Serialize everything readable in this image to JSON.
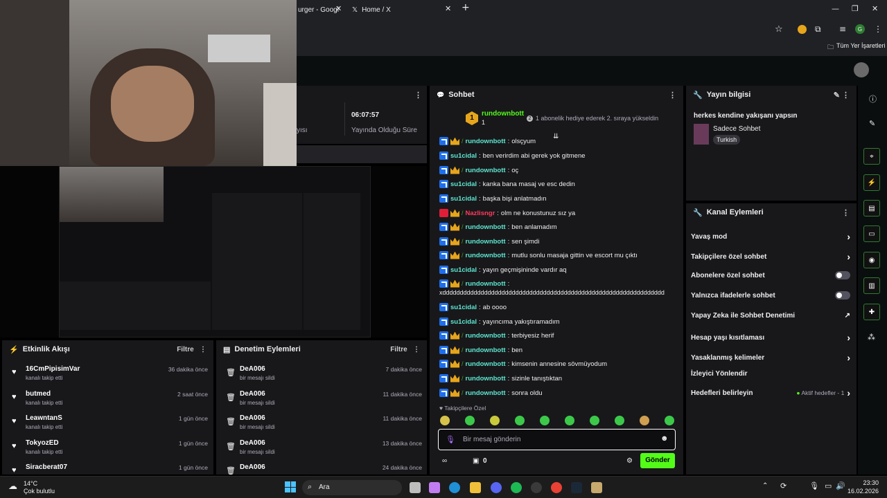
{
  "browser": {
    "tab1_label": "urger - Googl",
    "tab2_label": "Home / X",
    "new_tab": "+",
    "bookmarks_label": "Tüm Yer İşaretleri",
    "profile_initial": "G"
  },
  "stats": {
    "time_value": "06:07:57",
    "time_label": "Yayında Olduğu Süre",
    "partial_label": "yısı"
  },
  "chat": {
    "title": "Sohbet",
    "pinned_user": "rundownbott",
    "pinned_count": "1",
    "pinned_rank": "1",
    "gift_badge": "2",
    "gift_text": "1 abonelik hediye ederek 2. sıraya yükseldin",
    "messages": [
      {
        "badge": "mod",
        "crown": true,
        "user": "rundownbott",
        "color": "teal",
        "text": " olsçyum"
      },
      {
        "badge": "mod",
        "crown": false,
        "user": "su1cidal",
        "color": "teal",
        "text": "ben verirdim abi gerek yok gitmene"
      },
      {
        "badge": "mod",
        "crown": true,
        "user": "rundownbott",
        "color": "teal",
        "text": "oç"
      },
      {
        "badge": "mod",
        "crown": false,
        "user": "su1cidal",
        "color": "teal",
        "text": "kanka bana masaj ve esc dedin"
      },
      {
        "badge": "mod",
        "crown": false,
        "user": "su1cidal",
        "color": "teal",
        "text": "başka bişi anlatmadın"
      },
      {
        "badge": "red",
        "crown": true,
        "user": "Nazlisngr",
        "color": "red",
        "text": "olm ne konustunuz sız ya"
      },
      {
        "badge": "mod",
        "crown": true,
        "user": "rundownbott",
        "color": "teal",
        "text": "ben anlamadım"
      },
      {
        "badge": "mod",
        "crown": true,
        "user": "rundownbott",
        "color": "teal",
        "text": "sen şimdi"
      },
      {
        "badge": "mod",
        "crown": true,
        "user": "rundownbott",
        "color": "teal",
        "text": "mutlu sonlu masaja gittin ve escort mu çıktı"
      },
      {
        "badge": "mod",
        "crown": false,
        "user": "su1cidal",
        "color": "teal",
        "text": "yayın geçmişininde vardır aq"
      },
      {
        "badge": "mod",
        "crown": true,
        "user": "rundownbott",
        "color": "teal",
        "text": ""
      },
      {
        "badge": "none",
        "crown": false,
        "user": "",
        "color": "teal",
        "text": "xdddddddddddddddddddddddddddddddddddddddddddddddddddddddddddddddd"
      },
      {
        "badge": "mod",
        "crown": false,
        "user": "su1cidal",
        "color": "teal",
        "text": "ab oooo"
      },
      {
        "badge": "mod",
        "crown": false,
        "user": "su1cidal",
        "color": "teal",
        "text": "yayıncıma yakıştıramadım"
      },
      {
        "badge": "mod",
        "crown": true,
        "user": "rundownbott",
        "color": "teal",
        "text": "terbiyesiz herif"
      },
      {
        "badge": "mod",
        "crown": true,
        "user": "rundownbott",
        "color": "teal",
        "text": "ben"
      },
      {
        "badge": "mod",
        "crown": true,
        "user": "rundownbott",
        "color": "teal",
        "text": "kimsenin annesine sövmüyodum"
      },
      {
        "badge": "mod",
        "crown": true,
        "user": "rundownbott",
        "color": "teal",
        "text": "sizinle tanıştıktan"
      },
      {
        "badge": "mod",
        "crown": true,
        "user": "rundownbott",
        "color": "teal",
        "text": "sonra oldu"
      }
    ],
    "followers_only": "Takipçilere Özel",
    "input_placeholder": "Bir mesaj gönderin",
    "points": "0",
    "send_label": "Gönder"
  },
  "stream_info": {
    "title": "Yayın bilgisi",
    "stream_title": "herkes kendine yakışanı yapsın",
    "category": "Sadece Sohbet",
    "tag": "Turkish"
  },
  "channel_actions": {
    "title": "Kanal Eylemleri",
    "items": [
      {
        "label": "Yavaş mod",
        "type": "chevron"
      },
      {
        "label": "Takipçilere özel sohbet",
        "type": "chevron"
      },
      {
        "label": "Abonelere özel sohbet",
        "type": "toggle"
      },
      {
        "label": "Yalnızca ifadelerle sohbet",
        "type": "toggle"
      },
      {
        "label": "Yapay Zeka ile Sohbet Denetimi",
        "type": "external"
      },
      {
        "label": "Hesap yaşı kısıtlaması",
        "type": "chevron"
      },
      {
        "label": "Yasaklanmış kelimeler",
        "type": "chevron"
      },
      {
        "label": "İzleyici Yönlendir",
        "type": "none"
      },
      {
        "label": "Hedefleri belirleyin",
        "type": "goal"
      }
    ],
    "goal_status": "Aktif hedefler - 1"
  },
  "activity": {
    "title": "Etkinlik Akışı",
    "filter": "Filtre",
    "rows": [
      {
        "name": "16CmPipisimVar",
        "sub": "kanalı takip etti",
        "time": "36 dakika önce"
      },
      {
        "name": "butmed",
        "sub": "kanalı takip etti",
        "time": "2 saat önce"
      },
      {
        "name": "LeawntanS",
        "sub": "kanalı takip etti",
        "time": "1 gün önce"
      },
      {
        "name": "TokyozED",
        "sub": "kanalı takip etti",
        "time": "1 gün önce"
      },
      {
        "name": "Siracberat07",
        "sub": "",
        "time": "1 gün önce"
      }
    ]
  },
  "moderation": {
    "title": "Denetim Eylemleri",
    "filter": "Filtre",
    "rows": [
      {
        "name": "DeA006",
        "sub": "bir mesajı sildi",
        "time": "7 dakika önce"
      },
      {
        "name": "DeA006",
        "sub": "bir mesajı sildi",
        "time": "11 dakika önce"
      },
      {
        "name": "DeA006",
        "sub": "bir mesajı sildi",
        "time": "11 dakika önce"
      },
      {
        "name": "DeA006",
        "sub": "bir mesajı sildi",
        "time": "13 dakika önce"
      },
      {
        "name": "DeA006",
        "sub": "",
        "time": "24 dakika önce"
      }
    ]
  },
  "taskbar": {
    "weather_temp": "14°C",
    "weather_desc": "Çok bulutlu",
    "search_label": "Ara",
    "time": "23:30",
    "date": "16.02.2026"
  },
  "colors": {
    "accent": "#53fc18",
    "panel": "#18181b",
    "background": "#000000"
  }
}
